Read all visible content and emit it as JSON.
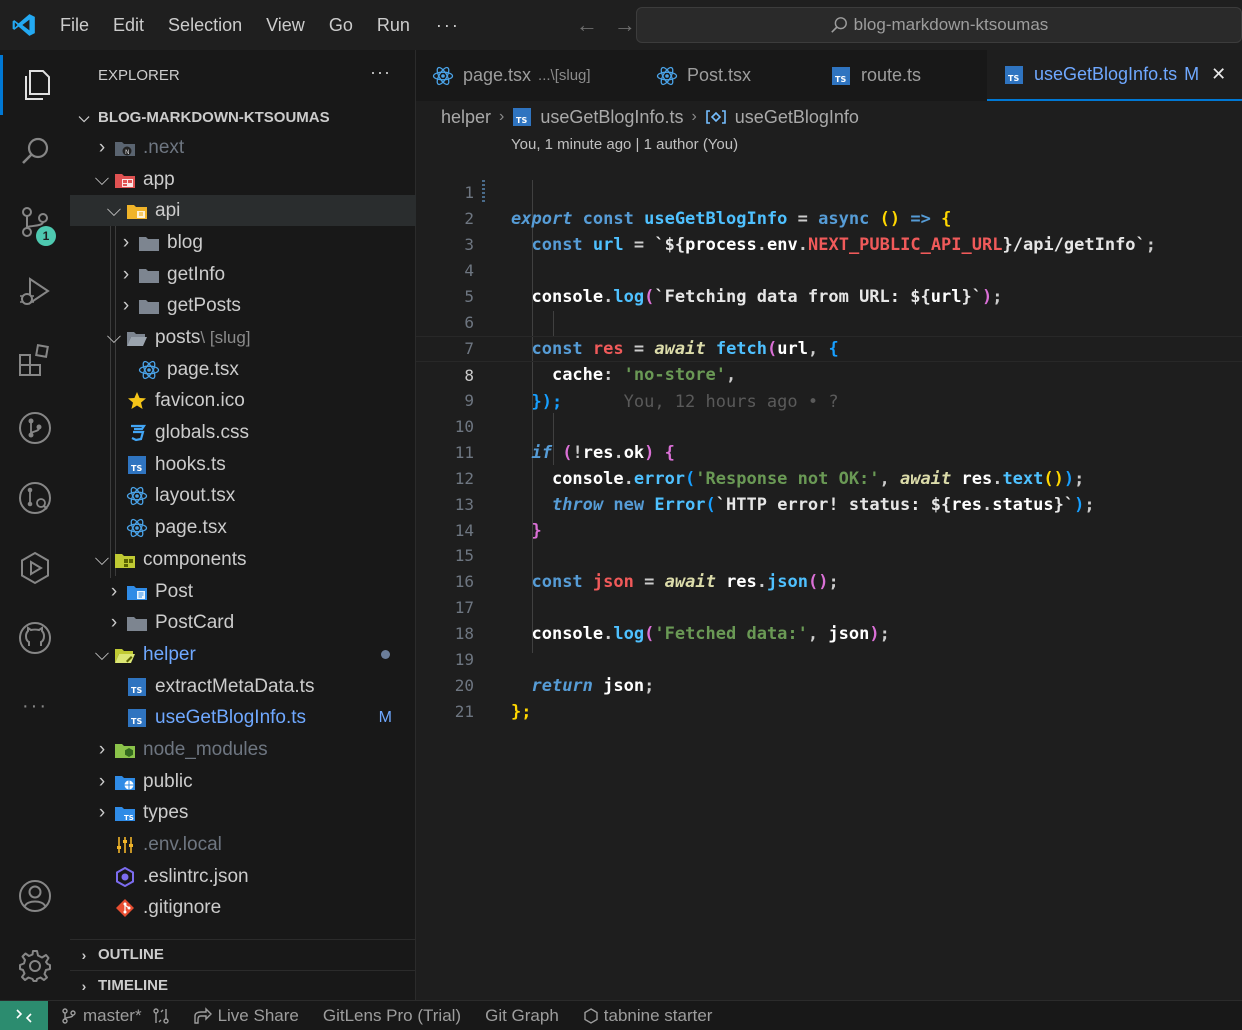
{
  "titlebar": {
    "menu": [
      "File",
      "Edit",
      "Selection",
      "View",
      "Go",
      "Run"
    ],
    "more": "···",
    "back_arrow": "←",
    "forward_arrow": "→",
    "search_text": "blog-markdown-ktsoumas"
  },
  "activity": {
    "source_control_badge": "1",
    "more": "···"
  },
  "sidebar": {
    "title": "EXPLORER",
    "more": "···",
    "root": "BLOG-MARKDOWN-KTSOUMAS",
    "items": [
      {
        "label": ".next",
        "dim": true
      },
      {
        "label": "app"
      },
      {
        "label": "api"
      },
      {
        "label": "blog"
      },
      {
        "label": "getInfo"
      },
      {
        "label": "getPosts"
      },
      {
        "label": "posts",
        "sub": "\\ [slug]"
      },
      {
        "label": "page.tsx"
      },
      {
        "label": "favicon.ico"
      },
      {
        "label": "globals.css"
      },
      {
        "label": "hooks.ts"
      },
      {
        "label": "layout.tsx"
      },
      {
        "label": "page.tsx"
      },
      {
        "label": "components"
      },
      {
        "label": "Post"
      },
      {
        "label": "PostCard"
      },
      {
        "label": "helper"
      },
      {
        "label": "extractMetaData.ts"
      },
      {
        "label": "useGetBlogInfo.ts",
        "decoration": "M"
      },
      {
        "label": "node_modules",
        "dim": true
      },
      {
        "label": "public"
      },
      {
        "label": "types"
      },
      {
        "label": ".env.local",
        "dim": true
      },
      {
        "label": ".eslintrc.json"
      },
      {
        "label": ".gitignore"
      }
    ],
    "outline": "OUTLINE",
    "timeline": "TIMELINE"
  },
  "tabs": [
    {
      "label": "page.tsx",
      "hint": "...\\[slug]"
    },
    {
      "label": "Post.tsx"
    },
    {
      "label": "route.ts"
    },
    {
      "label": "useGetBlogInfo.ts",
      "flag": "M",
      "close": "✕"
    }
  ],
  "breadcrumb": {
    "folder": "helper",
    "file": "useGetBlogInfo.ts",
    "symbol": "useGetBlogInfo"
  },
  "editor": {
    "blame_header": "You, 1 minute ago | 1 author (You)",
    "line_numbers": [
      "1",
      "2",
      "3",
      "4",
      "5",
      "6",
      "7",
      "8",
      "9",
      "10",
      "11",
      "12",
      "13",
      "14",
      "15",
      "16",
      "17",
      "18",
      "19",
      "20",
      "21"
    ],
    "current_line_number": "8",
    "inline_blame": "You, 12 hours ago • ?",
    "t": {
      "export": "export",
      "const": "const",
      "useGetBlogInfo": "useGetBlogInfo",
      "eq": "=",
      "async": "async",
      "parens": "()",
      "arrow": "=>",
      "lbrace": "{",
      "rbrace": "}",
      "url": "url",
      "tick": "`",
      "dollar_open": "${",
      "process": "process",
      "dot": ".",
      "env": "env",
      "api_env": "NEXT_PUBLIC_API_URL",
      "dollar_close": "}",
      "api_path": "/api/getInfo",
      "semi": ";",
      "console": "console",
      "log": "log",
      "lparen": "(",
      "rparen": ")",
      "fetching_text": "Fetching data from URL: ",
      "res": "res",
      "await": "await",
      "fetch": "fetch",
      "comma": ",",
      "cache": "cache",
      "colon": ":",
      "no_store": "'no-store'",
      "close_obj_call": "});",
      "if": "if",
      "bang": "!",
      "ok": "ok",
      "error": "error",
      "response_not_ok": "'Response not OK:'",
      "text": "text",
      "throw": "throw",
      "new": "new",
      "Error": "Error",
      "http_error": "HTTP error! status: ",
      "status": "status",
      "json": "json",
      "fetched_data": "'Fetched data:'",
      "return": "return",
      "end": "};"
    }
  },
  "statusbar": {
    "branch": "master*",
    "live_share": "Live Share",
    "gitlens": "GitLens Pro (Trial)",
    "git_graph": "Git Graph",
    "tabnine": "tabnine starter"
  }
}
